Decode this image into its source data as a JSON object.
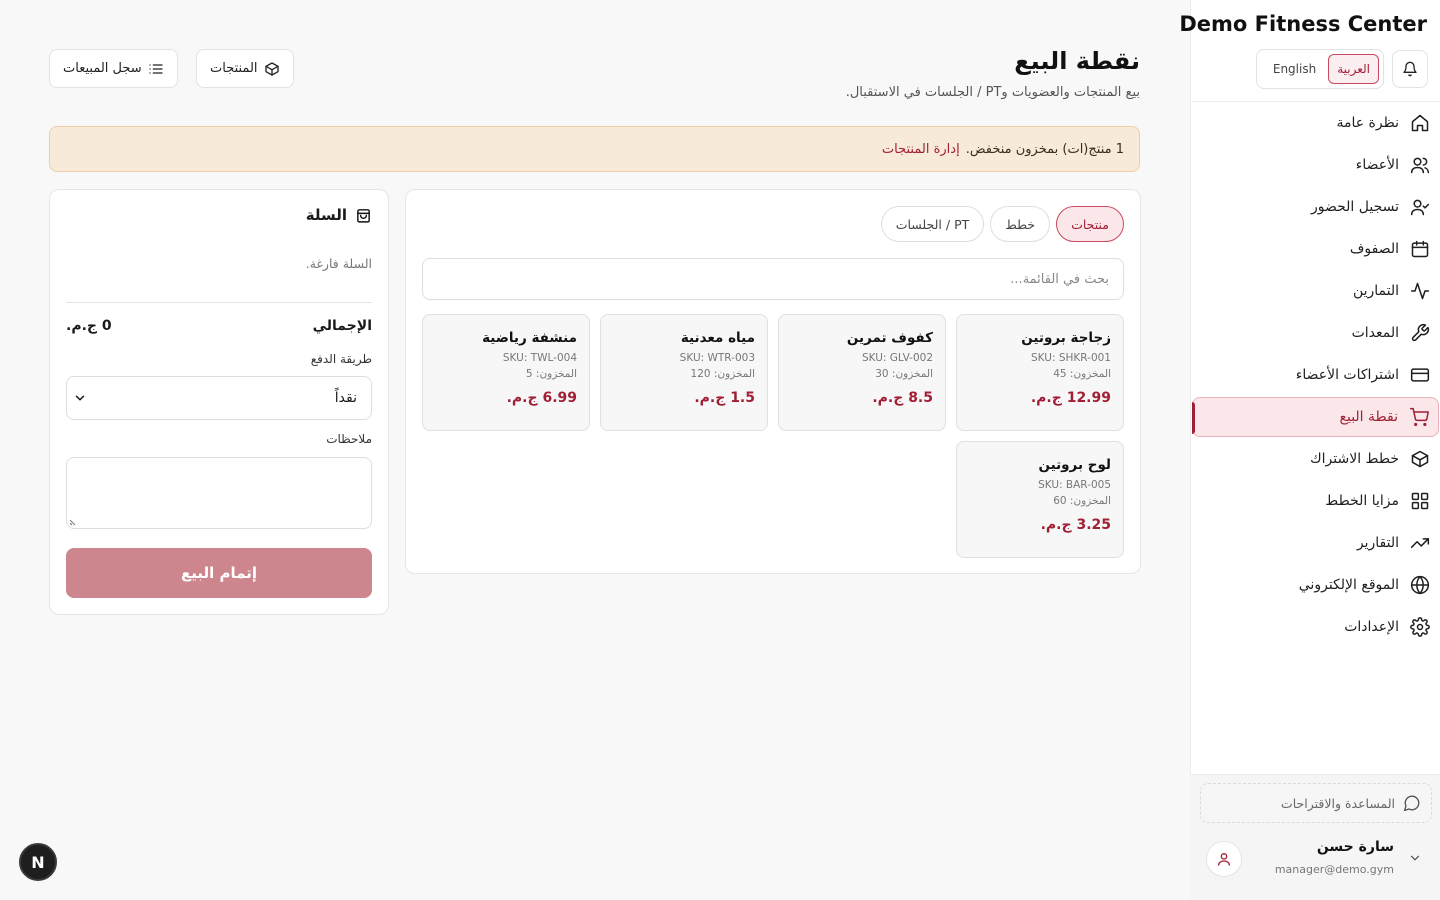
{
  "brand": "Demo Fitness Center",
  "lang": {
    "arabic": "العربية",
    "english": "English"
  },
  "nav": [
    {
      "label": "نظرة عامة",
      "icon": "home-icon"
    },
    {
      "label": "الأعضاء",
      "icon": "users-icon"
    },
    {
      "label": "تسجيل الحضور",
      "icon": "user-check-icon"
    },
    {
      "label": "الصفوف",
      "icon": "calendar-icon"
    },
    {
      "label": "التمارين",
      "icon": "activity-icon"
    },
    {
      "label": "المعدات",
      "icon": "wrench-icon"
    },
    {
      "label": "اشتراكات الأعضاء",
      "icon": "credit-card-icon"
    },
    {
      "label": "نقطة البيع",
      "icon": "cart-icon",
      "active": true
    },
    {
      "label": "خطط الاشتراك",
      "icon": "package-icon"
    },
    {
      "label": "مزايا الخطط",
      "icon": "grid-icon"
    },
    {
      "label": "التقارير",
      "icon": "trending-up-icon"
    },
    {
      "label": "الموقع الإلكتروني",
      "icon": "globe-icon"
    },
    {
      "label": "الإعدادات",
      "icon": "settings-icon"
    }
  ],
  "help": "المساعدة والاقتراحات",
  "user": {
    "name": "سارة حسن",
    "email": "manager@demo.gym"
  },
  "header": {
    "title": "نقطة البيع",
    "subtitle": "بيع المنتجات والعضويات وPT / الجلسات في الاستقبال.",
    "products_btn": "المنتجات",
    "sales_log_btn": "سجل المبيعات"
  },
  "alert": {
    "text": "1 منتج(ات) بمخزون منخفض.",
    "link": "إدارة المنتجات"
  },
  "tabs": [
    "منتجات",
    "خطط",
    "PT / الجلسات"
  ],
  "search_placeholder": "بحث في القائمة...",
  "products": [
    {
      "name": "زجاجة بروتين",
      "sku": "SKU: SHKR-001",
      "stock": "المخزون: 45",
      "price": "12.99 ج.م."
    },
    {
      "name": "كفوف تمرين",
      "sku": "SKU: GLV-002",
      "stock": "المخزون: 30",
      "price": "8.5 ج.م."
    },
    {
      "name": "مياه معدنية",
      "sku": "SKU: WTR-003",
      "stock": "المخزون: 120",
      "price": "1.5 ج.م."
    },
    {
      "name": "منشفة رياضية",
      "sku": "SKU: TWL-004",
      "stock": "المخزون: 5",
      "price": "6.99 ج.م."
    },
    {
      "name": "لوح بروتين",
      "sku": "SKU: BAR-005",
      "stock": "المخزون: 60",
      "price": "3.25 ج.م."
    }
  ],
  "cart": {
    "title": "السلة",
    "empty": "السلة فارغة.",
    "total_label": "الإجمالي",
    "total_value": "0 ج.م.",
    "payment_label": "طريقة الدفع",
    "payment_value": "نقداً",
    "notes_label": "ملاحظات",
    "checkout": "إتمام البيع"
  },
  "fab": "N",
  "colors": {
    "accent": "#a11f35",
    "accent_soft": "#fbe6e9",
    "checkout": "#cd868e",
    "alert_bg": "#f8ead8"
  }
}
